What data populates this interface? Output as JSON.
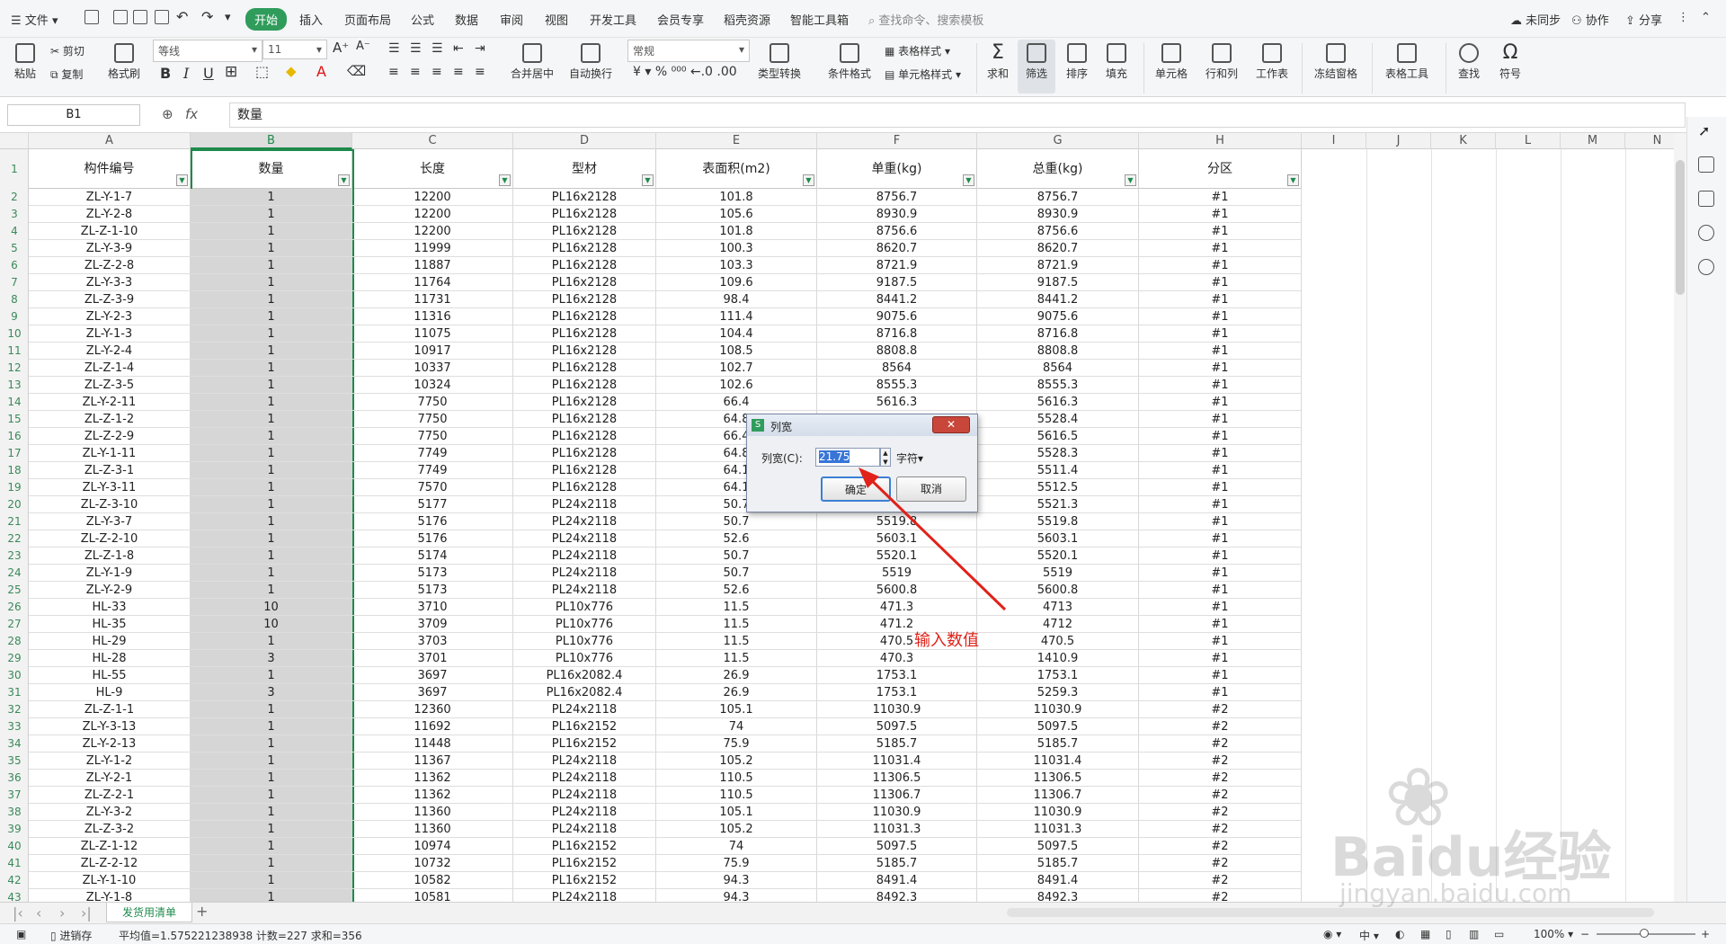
{
  "menubar": {
    "file_label": "文件",
    "tabs": [
      "开始",
      "插入",
      "页面布局",
      "公式",
      "数据",
      "审阅",
      "视图",
      "开发工具",
      "会员专享",
      "稻壳资源",
      "智能工具箱"
    ],
    "active_tab": "开始",
    "search_placeholder": "查找命令、搜索模板",
    "sync_label": "未同步",
    "collab_label": "协作",
    "share_label": "分享"
  },
  "ribbon": {
    "paste": "粘贴",
    "cut": "剪切",
    "copy": "复制",
    "format_painter": "格式刷",
    "font_name": "等线",
    "font_size": "11",
    "merge_center": "合并居中",
    "wrap_text": "自动换行",
    "number_format": "常规",
    "type_convert": "类型转换",
    "conditional_format": "条件格式",
    "table_style": "表格样式",
    "cell_style": "单元格样式",
    "sum": "求和",
    "filter": "筛选",
    "sort": "排序",
    "fill": "填充",
    "cell": "单元格",
    "row_col": "行和列",
    "worksheet": "工作表",
    "freeze": "冻结窗格",
    "table_tools": "表格工具",
    "find": "查找",
    "symbol": "符号"
  },
  "formula_bar": {
    "name_box": "B1",
    "fx": "fx",
    "content": "数量"
  },
  "column_letters": [
    "A",
    "B",
    "C",
    "D",
    "E",
    "F",
    "G",
    "H",
    "I",
    "J",
    "K",
    "L",
    "M",
    "N"
  ],
  "table": {
    "headers": [
      "构件编号",
      "数量",
      "长度",
      "型材",
      "表面积(m2)",
      "单重(kg)",
      "总重(kg)",
      "分区"
    ],
    "rows": [
      [
        "ZL-Y-1-7",
        "1",
        "12200",
        "PL16x2128",
        "101.8",
        "8756.7",
        "8756.7",
        "#1"
      ],
      [
        "ZL-Y-2-8",
        "1",
        "12200",
        "PL16x2128",
        "105.6",
        "8930.9",
        "8930.9",
        "#1"
      ],
      [
        "ZL-Z-1-10",
        "1",
        "12200",
        "PL16x2128",
        "101.8",
        "8756.6",
        "8756.6",
        "#1"
      ],
      [
        "ZL-Y-3-9",
        "1",
        "11999",
        "PL16x2128",
        "100.3",
        "8620.7",
        "8620.7",
        "#1"
      ],
      [
        "ZL-Z-2-8",
        "1",
        "11887",
        "PL16x2128",
        "103.3",
        "8721.9",
        "8721.9",
        "#1"
      ],
      [
        "ZL-Y-3-3",
        "1",
        "11764",
        "PL16x2128",
        "109.6",
        "9187.5",
        "9187.5",
        "#1"
      ],
      [
        "ZL-Z-3-9",
        "1",
        "11731",
        "PL16x2128",
        "98.4",
        "8441.2",
        "8441.2",
        "#1"
      ],
      [
        "ZL-Y-2-3",
        "1",
        "11316",
        "PL16x2128",
        "111.4",
        "9075.6",
        "9075.6",
        "#1"
      ],
      [
        "ZL-Y-1-3",
        "1",
        "11075",
        "PL16x2128",
        "104.4",
        "8716.8",
        "8716.8",
        "#1"
      ],
      [
        "ZL-Y-2-4",
        "1",
        "10917",
        "PL16x2128",
        "108.5",
        "8808.8",
        "8808.8",
        "#1"
      ],
      [
        "ZL-Z-1-4",
        "1",
        "10337",
        "PL16x2128",
        "102.7",
        "8564",
        "8564",
        "#1"
      ],
      [
        "ZL-Z-3-5",
        "1",
        "10324",
        "PL16x2128",
        "102.6",
        "8555.3",
        "8555.3",
        "#1"
      ],
      [
        "ZL-Y-2-11",
        "1",
        "7750",
        "PL16x2128",
        "66.4",
        "5616.3",
        "5616.3",
        "#1"
      ],
      [
        "ZL-Z-1-2",
        "1",
        "7750",
        "PL16x2128",
        "64.8",
        "",
        "5528.4",
        "#1"
      ],
      [
        "ZL-Z-2-9",
        "1",
        "7750",
        "PL16x2128",
        "66.4",
        "",
        "5616.5",
        "#1"
      ],
      [
        "ZL-Y-1-11",
        "1",
        "7749",
        "PL16x2128",
        "64.8",
        "",
        "5528.3",
        "#1"
      ],
      [
        "ZL-Z-3-1",
        "1",
        "7749",
        "PL16x2128",
        "64.1",
        "",
        "5511.4",
        "#1"
      ],
      [
        "ZL-Y-3-11",
        "1",
        "7570",
        "PL16x2128",
        "64.1",
        "",
        "5512.5",
        "#1"
      ],
      [
        "ZL-Z-3-10",
        "1",
        "5177",
        "PL24x2118",
        "50.7",
        "",
        "5521.3",
        "#1"
      ],
      [
        "ZL-Y-3-7",
        "1",
        "5176",
        "PL24x2118",
        "50.7",
        "5519.8",
        "5519.8",
        "#1"
      ],
      [
        "ZL-Z-2-10",
        "1",
        "5176",
        "PL24x2118",
        "52.6",
        "5603.1",
        "5603.1",
        "#1"
      ],
      [
        "ZL-Z-1-8",
        "1",
        "5174",
        "PL24x2118",
        "50.7",
        "5520.1",
        "5520.1",
        "#1"
      ],
      [
        "ZL-Y-1-9",
        "1",
        "5173",
        "PL24x2118",
        "50.7",
        "5519",
        "5519",
        "#1"
      ],
      [
        "ZL-Y-2-9",
        "1",
        "5173",
        "PL24x2118",
        "52.6",
        "5600.8",
        "5600.8",
        "#1"
      ],
      [
        "HL-33",
        "10",
        "3710",
        "PL10x776",
        "11.5",
        "471.3",
        "4713",
        "#1"
      ],
      [
        "HL-35",
        "10",
        "3709",
        "PL10x776",
        "11.5",
        "471.2",
        "4712",
        "#1"
      ],
      [
        "HL-29",
        "1",
        "3703",
        "PL10x776",
        "11.5",
        "470.5",
        "470.5",
        "#1"
      ],
      [
        "HL-28",
        "3",
        "3701",
        "PL10x776",
        "11.5",
        "470.3",
        "1410.9",
        "#1"
      ],
      [
        "HL-55",
        "1",
        "3697",
        "PL16x2082.4",
        "26.9",
        "1753.1",
        "1753.1",
        "#1"
      ],
      [
        "HL-9",
        "3",
        "3697",
        "PL16x2082.4",
        "26.9",
        "1753.1",
        "5259.3",
        "#1"
      ],
      [
        "ZL-Z-1-1",
        "1",
        "12360",
        "PL24x2118",
        "105.1",
        "11030.9",
        "11030.9",
        "#2"
      ],
      [
        "ZL-Y-3-13",
        "1",
        "11692",
        "PL16x2152",
        "74",
        "5097.5",
        "5097.5",
        "#2"
      ],
      [
        "ZL-Y-2-13",
        "1",
        "11448",
        "PL16x2152",
        "75.9",
        "5185.7",
        "5185.7",
        "#2"
      ],
      [
        "ZL-Y-1-2",
        "1",
        "11367",
        "PL24x2118",
        "105.2",
        "11031.4",
        "11031.4",
        "#2"
      ],
      [
        "ZL-Y-2-1",
        "1",
        "11362",
        "PL24x2118",
        "110.5",
        "11306.5",
        "11306.5",
        "#2"
      ],
      [
        "ZL-Z-2-1",
        "1",
        "11362",
        "PL24x2118",
        "110.5",
        "11306.7",
        "11306.7",
        "#2"
      ],
      [
        "ZL-Y-3-2",
        "1",
        "11360",
        "PL24x2118",
        "105.1",
        "11030.9",
        "11030.9",
        "#2"
      ],
      [
        "ZL-Z-3-2",
        "1",
        "11360",
        "PL24x2118",
        "105.2",
        "11031.3",
        "11031.3",
        "#2"
      ],
      [
        "ZL-Z-1-12",
        "1",
        "10974",
        "PL16x2152",
        "74",
        "5097.5",
        "5097.5",
        "#2"
      ],
      [
        "ZL-Z-2-12",
        "1",
        "10732",
        "PL16x2152",
        "75.9",
        "5185.7",
        "5185.7",
        "#2"
      ],
      [
        "ZL-Y-1-10",
        "1",
        "10582",
        "PL16x2152",
        "94.3",
        "8491.4",
        "8491.4",
        "#2"
      ],
      [
        "ZL-Y-1-8",
        "1",
        "10581",
        "PL24x2118",
        "94.3",
        "8492.3",
        "8492.3",
        "#2"
      ]
    ]
  },
  "dialog": {
    "title": "列宽",
    "label": "列宽(C):",
    "value": "21.75",
    "unit": "字符",
    "ok": "确定",
    "cancel": "取消"
  },
  "annotation": "输入数值",
  "sheet_tab": "发货用清单",
  "status": {
    "mode": "进销存",
    "summary": "平均值=1.575221238938  计数=227  求和=356",
    "zoom": "100%"
  },
  "watermark": "Baidu经验",
  "watermark_sub": "jingyan.baidu.com",
  "colors": {
    "accent": "#1e8a4c",
    "selection_fill": "#d6d6d6",
    "annotation": "#e0221a"
  }
}
